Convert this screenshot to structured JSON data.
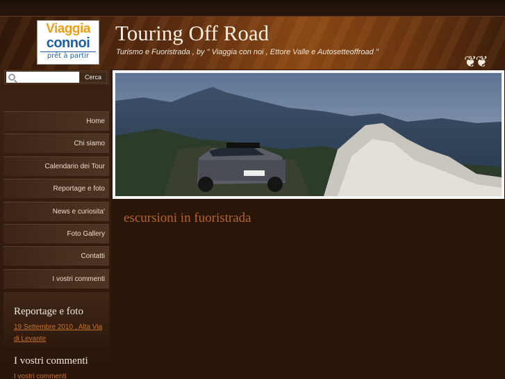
{
  "logo": {
    "line1": "Viaggia",
    "line2": "connoi",
    "line3": "prêt à partir"
  },
  "header": {
    "title": "Touring Off Road",
    "tagline": "Turismo e Fuoristrada , by \" Viaggia con noi , Ettore Valle e Autosetteoffroad \""
  },
  "search": {
    "button_label": "Cerca",
    "value": ""
  },
  "nav": {
    "items": [
      {
        "label": "Home"
      },
      {
        "label": "Chi siamo"
      },
      {
        "label": "Calendario dei Tour"
      },
      {
        "label": "Reportage e foto"
      },
      {
        "label": "News e curiosita'"
      },
      {
        "label": "Foto Gallery"
      },
      {
        "label": "Contatti"
      },
      {
        "label": "I vostri commenti"
      }
    ]
  },
  "sidebar": {
    "reportage": {
      "heading": "Reportage e foto",
      "link": "19 Settembre 2010 , Alta Via di Levante"
    },
    "comments": {
      "heading": "I vostri commenti",
      "link": "I vostri commenti"
    }
  },
  "content": {
    "title": "escursioni in fuoristrada"
  },
  "colors": {
    "accent": "#b5642a",
    "link": "#c8742c",
    "background": "#2a1509"
  }
}
